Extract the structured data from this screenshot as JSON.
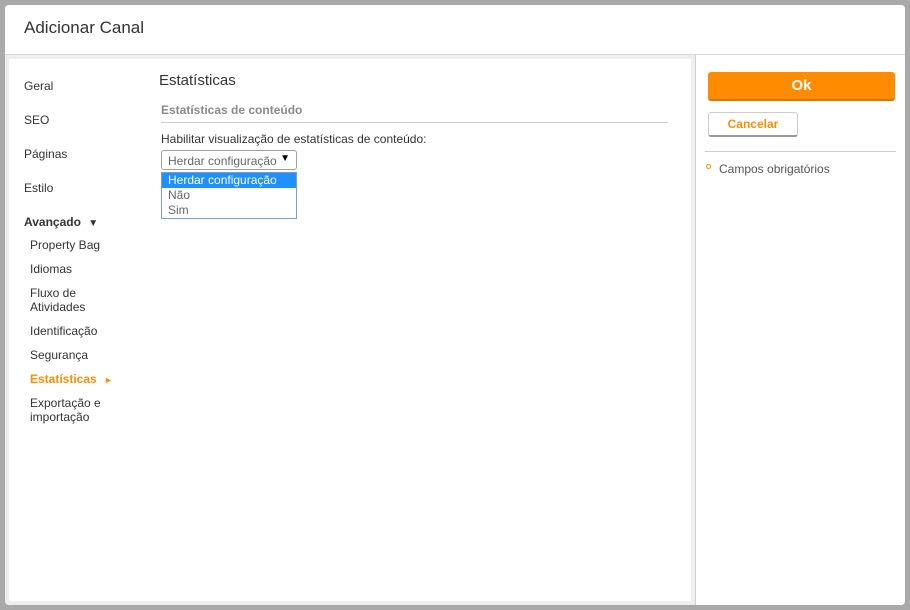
{
  "dialog": {
    "title": "Adicionar Canal"
  },
  "nav": {
    "items": [
      "Geral",
      "SEO",
      "Páginas",
      "Estilo"
    ],
    "group": {
      "label": "Avançado",
      "arrow": "▼"
    },
    "subitems": [
      "Property Bag",
      "Idiomas",
      "Fluxo de Atividades",
      "Identificação",
      "Segurança",
      "Estatísticas",
      "Exportação e importação"
    ],
    "active_arrow": "►"
  },
  "content": {
    "section_title": "Estatísticas",
    "subsection_title": "Estatísticas de conteúdo",
    "field_label": "Habilitar visualização de estatísticas de conteúdo:",
    "select": {
      "value": "Herdar configuração",
      "arrow": "▼",
      "options": [
        "Herdar configuração",
        "Não",
        "Sim"
      ]
    }
  },
  "actions": {
    "ok_label": "Ok",
    "cancel_label": "Cancelar",
    "required_text": "Campos obrigatórios"
  },
  "colors": {
    "accent": "#ff8c00",
    "selected_option": "#1e90ff"
  }
}
